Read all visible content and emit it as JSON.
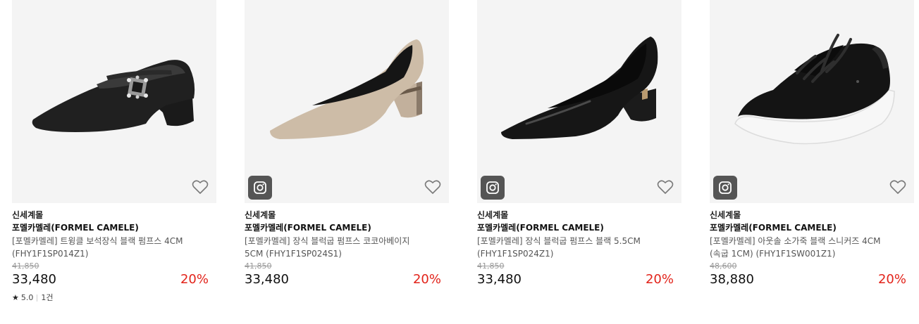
{
  "products": [
    {
      "mall": "신세계몰",
      "brand": "포멜카멜레(FORMEL CAMELE)",
      "name": "[포멜카멜레] 트윙클 보석장식 블랙 펌프스 4CM (FHY1F1SP014Z1)",
      "original_price": "41,850",
      "price": "33,480",
      "discount": "20%",
      "rating": "5.0",
      "review_count": "1건",
      "has_insta_badge": false,
      "shoe_icon": "black-mary-jane-pump-with-jewel",
      "color": "#1c1c1c"
    },
    {
      "mall": "신세계몰",
      "brand": "포멜카멜레(FORMEL CAMELE)",
      "name": "[포멜카멜레] 장식 블럭굽 펌프스 코코아베이지 5CM (FHY1F1SP024S1)",
      "original_price": "41,850",
      "price": "33,480",
      "discount": "20%",
      "has_insta_badge": true,
      "shoe_icon": "beige-block-heel-pump",
      "color": "#c8b8a3"
    },
    {
      "mall": "신세계몰",
      "brand": "포멜카멜레(FORMEL CAMELE)",
      "name": "[포멜카멜레] 장식 블럭굽 펌프스 블랙 5.5CM (FHY1F1SP024Z1)",
      "original_price": "41,850",
      "price": "33,480",
      "discount": "20%",
      "has_insta_badge": true,
      "shoe_icon": "black-block-heel-pump",
      "color": "#141414"
    },
    {
      "mall": "신세계몰",
      "brand": "포멜카멜레(FORMEL CAMELE)",
      "name": "[포멜카멜레] 아웃솔 소가죽 블랙 스니커즈 4CM (속굽 1CM) (FHY1F1SW001Z1)",
      "original_price": "48,600",
      "price": "38,880",
      "discount": "20%",
      "has_insta_badge": true,
      "shoe_icon": "black-leather-sneaker",
      "color": "#111111"
    }
  ],
  "icons": {
    "wishlist": "heart-outline-icon",
    "instagram": "instagram-icon",
    "rating": "star-icon"
  },
  "accent_colors": {
    "discount": "#e2231a",
    "badge_bg": "#555555",
    "thumb_bg": "#f4f4f4"
  }
}
